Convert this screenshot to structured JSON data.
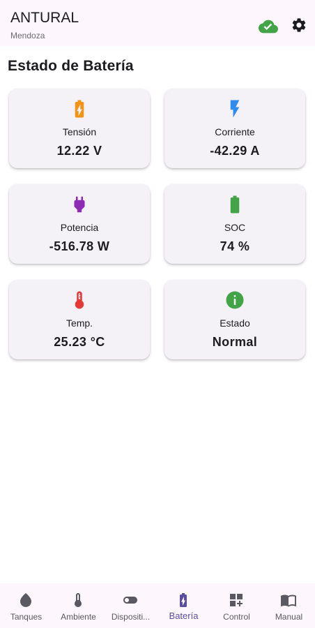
{
  "header": {
    "title": "ANTURAL",
    "subtitle": "Mendoza",
    "cloud_icon": "cloud-check-icon",
    "settings_icon": "gear-icon"
  },
  "page": {
    "heading": "Estado de Batería"
  },
  "cards": [
    {
      "icon": "battery-charging-icon",
      "icon_color": "#f29318",
      "label": "Tensión",
      "value": "12.22 V"
    },
    {
      "icon": "lightning-bolt-icon",
      "icon_color": "#2f8df0",
      "label": "Corriente",
      "value": "-42.29 A"
    },
    {
      "icon": "power-plug-icon",
      "icon_color": "#8e2bb5",
      "label": "Potencia",
      "value": "-516.78 W"
    },
    {
      "icon": "battery-full-icon",
      "icon_color": "#43a447",
      "label": "SOC",
      "value": "74 %"
    },
    {
      "icon": "thermometer-icon",
      "icon_color": "#e53935",
      "label": "Temp.",
      "value": "25.23 °C"
    },
    {
      "icon": "info-icon",
      "icon_color": "#43a447",
      "label": "Estado",
      "value": "Normal"
    }
  ],
  "nav": {
    "active": "Batería",
    "items": [
      {
        "label": "Tanques",
        "icon": "water-drop-icon"
      },
      {
        "label": "Ambiente",
        "icon": "thermometer-icon"
      },
      {
        "label": "Dispositi...",
        "icon": "toggle-icon"
      },
      {
        "label": "Batería",
        "icon": "battery-charging-icon"
      },
      {
        "label": "Control",
        "icon": "dashboard-add-icon"
      },
      {
        "label": "Manual",
        "icon": "book-icon"
      }
    ]
  },
  "colors": {
    "cloud_green": "#43a447",
    "accent_purple": "#5b4d9e",
    "card_background": "#f5f2f7",
    "bar_background": "#fdf7fd"
  }
}
